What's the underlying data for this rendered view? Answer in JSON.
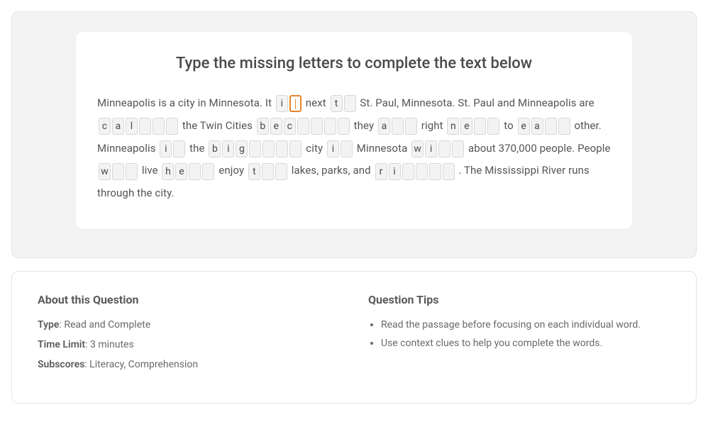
{
  "exercise": {
    "instruction": "Type the missing letters to complete the text below",
    "segments": [
      {
        "kind": "text",
        "value": "Minneapolis is a city in Minnesota. It "
      },
      {
        "kind": "word",
        "cells": [
          {
            "ch": "i"
          },
          {
            "ch": "",
            "active": true
          }
        ]
      },
      {
        "kind": "text",
        "value": " next "
      },
      {
        "kind": "word",
        "cells": [
          {
            "ch": "t"
          },
          {
            "ch": ""
          }
        ]
      },
      {
        "kind": "text",
        "value": " St. Paul, Minnesota. St. Paul and Minneapolis are "
      },
      {
        "kind": "word",
        "cells": [
          {
            "ch": "c"
          },
          {
            "ch": "a"
          },
          {
            "ch": "l"
          },
          {
            "ch": ""
          },
          {
            "ch": ""
          },
          {
            "ch": ""
          }
        ]
      },
      {
        "kind": "text",
        "value": " the Twin Cities "
      },
      {
        "kind": "word",
        "cells": [
          {
            "ch": "b"
          },
          {
            "ch": "e"
          },
          {
            "ch": "c"
          },
          {
            "ch": ""
          },
          {
            "ch": ""
          },
          {
            "ch": ""
          },
          {
            "ch": ""
          }
        ]
      },
      {
        "kind": "text",
        "value": " they "
      },
      {
        "kind": "word",
        "cells": [
          {
            "ch": "a"
          },
          {
            "ch": ""
          },
          {
            "ch": ""
          }
        ]
      },
      {
        "kind": "text",
        "value": " right "
      },
      {
        "kind": "word",
        "cells": [
          {
            "ch": "n"
          },
          {
            "ch": "e"
          },
          {
            "ch": ""
          },
          {
            "ch": ""
          }
        ]
      },
      {
        "kind": "text",
        "value": " to "
      },
      {
        "kind": "word",
        "cells": [
          {
            "ch": "e"
          },
          {
            "ch": "a"
          },
          {
            "ch": ""
          },
          {
            "ch": ""
          }
        ]
      },
      {
        "kind": "text",
        "value": " other. Minneapolis "
      },
      {
        "kind": "word",
        "cells": [
          {
            "ch": "i"
          },
          {
            "ch": ""
          }
        ]
      },
      {
        "kind": "text",
        "value": " the "
      },
      {
        "kind": "word",
        "cells": [
          {
            "ch": "b"
          },
          {
            "ch": "i"
          },
          {
            "ch": "g"
          },
          {
            "ch": ""
          },
          {
            "ch": ""
          },
          {
            "ch": ""
          },
          {
            "ch": ""
          }
        ]
      },
      {
        "kind": "text",
        "value": " city "
      },
      {
        "kind": "word",
        "cells": [
          {
            "ch": "i"
          },
          {
            "ch": ""
          }
        ]
      },
      {
        "kind": "text",
        "value": " Minnesota "
      },
      {
        "kind": "word",
        "cells": [
          {
            "ch": "w"
          },
          {
            "ch": "i"
          },
          {
            "ch": ""
          },
          {
            "ch": ""
          }
        ]
      },
      {
        "kind": "text",
        "value": " about 370,000 people. People "
      },
      {
        "kind": "word",
        "cells": [
          {
            "ch": "w"
          },
          {
            "ch": ""
          },
          {
            "ch": ""
          }
        ]
      },
      {
        "kind": "text",
        "value": " live "
      },
      {
        "kind": "word",
        "cells": [
          {
            "ch": "h"
          },
          {
            "ch": "e"
          },
          {
            "ch": ""
          },
          {
            "ch": ""
          }
        ]
      },
      {
        "kind": "text",
        "value": " enjoy "
      },
      {
        "kind": "word",
        "cells": [
          {
            "ch": "t"
          },
          {
            "ch": ""
          },
          {
            "ch": ""
          }
        ]
      },
      {
        "kind": "text",
        "value": " lakes, parks, and "
      },
      {
        "kind": "word",
        "cells": [
          {
            "ch": "r"
          },
          {
            "ch": "i"
          },
          {
            "ch": ""
          },
          {
            "ch": ""
          },
          {
            "ch": ""
          },
          {
            "ch": ""
          }
        ]
      },
      {
        "kind": "text",
        "value": " . The Mississippi River runs through the city."
      }
    ]
  },
  "about": {
    "title": "About this Question",
    "type_label": "Type",
    "type_value": ": Read and Complete",
    "time_label": "Time Limit",
    "time_value": ": 3 minutes",
    "subscores_label": "Subscores",
    "subscores_value": ": Literacy, Comprehension"
  },
  "tips": {
    "title": "Question Tips",
    "items": [
      "Read the passage before focusing on each individual word.",
      "Use context clues to help you complete the words."
    ]
  }
}
